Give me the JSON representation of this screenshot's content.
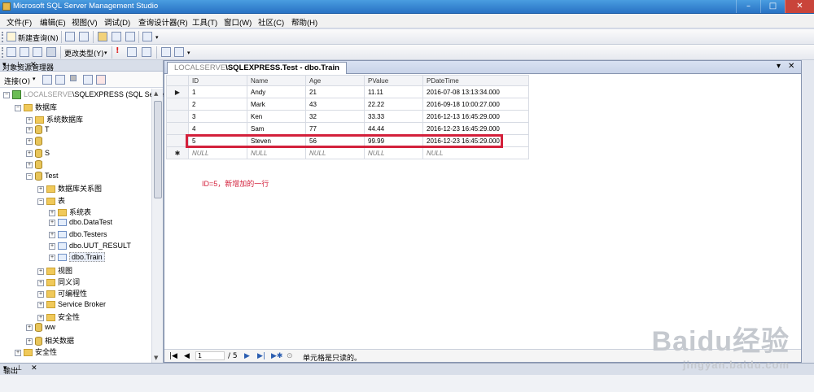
{
  "window": {
    "title": "Microsoft SQL Server Management Studio",
    "controls": [
      "–",
      "□",
      "✕"
    ]
  },
  "menu": [
    "文件(F)",
    "编辑(E)",
    "视图(V)",
    "调试(D)",
    "查询设计器(R)",
    "工具(T)",
    "窗口(W)",
    "社区(C)",
    "帮助(H)"
  ],
  "toolbar1": {
    "new_query": "新建查询(N)"
  },
  "toolbar2": {
    "change_type": "更改类型(Y)"
  },
  "object_explorer": {
    "title": "对象资源管理器",
    "pin_controls": "▾ ⊥ ✕",
    "connect_label": "连接(O)",
    "tree": [
      {
        "label": "\\SQLEXPRESS (SQL Server",
        "prefix": "LOCALSERVE"
      },
      {
        "label": "数据库"
      },
      {
        "label": "系统数据库"
      },
      {
        "label": "T"
      },
      {
        "label": ""
      },
      {
        "label": "S"
      },
      {
        "label": ""
      },
      {
        "label": "Test"
      },
      {
        "label": "数据库关系图"
      },
      {
        "label": "表"
      },
      {
        "label": "系统表"
      },
      {
        "label": "dbo.DataTest"
      },
      {
        "label": "dbo.Testers"
      },
      {
        "label": "dbo.UUT_RESULT"
      },
      {
        "label": "dbo.Train"
      },
      {
        "label": "视图"
      },
      {
        "label": "同义词"
      },
      {
        "label": "可编程性"
      },
      {
        "label": "Service Broker"
      },
      {
        "label": "安全性"
      },
      {
        "label": "ww"
      },
      {
        "label": "相关数据"
      },
      {
        "label": "安全性"
      }
    ]
  },
  "document": {
    "tab_label": "\\SQLEXPRESS.Test - dbo.Train",
    "tab_prefix": "LOCALSERVE",
    "columns": [
      "ID",
      "Name",
      "Age",
      "PValue",
      "PDateTime"
    ],
    "rows": [
      [
        "1",
        "Andy",
        "21",
        "11.11",
        "2016-07-08 13:13:34.000"
      ],
      [
        "2",
        "Mark",
        "43",
        "22.22",
        "2016-09-18 10:00:27.000"
      ],
      [
        "3",
        "Ken",
        "32",
        "33.33",
        "2016-12-13 16:45:29.000"
      ],
      [
        "4",
        "Sam",
        "77",
        "44.44",
        "2016-12-23 16:45:29.000"
      ],
      [
        "5",
        "Steven",
        "56",
        "99.99",
        "2016-12-23 16:45:29.000"
      ]
    ],
    "new_row": [
      "NULL",
      "NULL",
      "NULL",
      "NULL",
      "NULL"
    ],
    "annotation": "ID=5，新增加的一行",
    "nav": {
      "page": "1",
      "total": "/ 5",
      "status": "单元格是只读的。"
    }
  },
  "output": {
    "title": "输出",
    "controls": "▾ ⊥ ✕"
  },
  "watermark": {
    "brand": "Baidu经验",
    "url": "jingyan.baidu.com"
  },
  "colors": {
    "highlight": "#d3203b",
    "titlebar": "#2872c4"
  }
}
